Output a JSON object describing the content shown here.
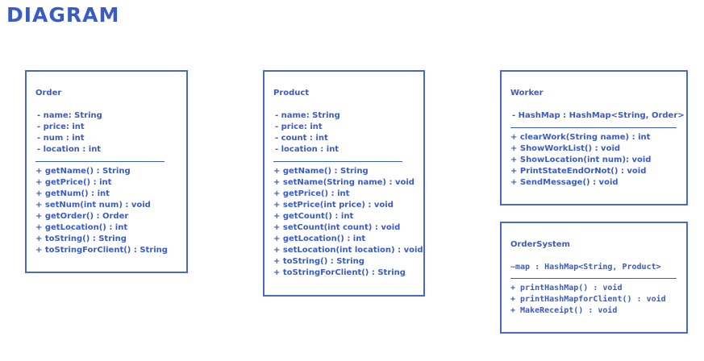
{
  "title": "DIAGRAM",
  "accent_color": "#3B5BC4",
  "classes": {
    "order": {
      "name": "Order",
      "attributes": [
        "- name: String",
        "- price: int",
        "- num : int",
        "- location : int"
      ],
      "methods": [
        "+ getName() : String",
        "+ getPrice() : int",
        "+ getNum() : int",
        "+ setNum(int num) : void",
        "+ getOrder() : Order",
        "+ getLocation() : int",
        "+ toString() : String",
        "+ toStringForClient() : String"
      ]
    },
    "product": {
      "name": "Product",
      "attributes": [
        "- name: String",
        "- price: int",
        "- count : int",
        "- location : int"
      ],
      "methods": [
        "+ getName() : String",
        "+ setName(String name) : void",
        "+ getPrice() : int",
        "+ setPrice(int price) : void",
        "+ getCount() : int",
        "+ setCount(int count) : void",
        "+ getLocation() : int",
        "+ setLocation(int location) : void",
        "+ toString() : String",
        "+ toStringForClient() : String"
      ]
    },
    "worker": {
      "name": "Worker",
      "attributes": [
        "- HashMap : HashMap<String, Order>"
      ],
      "methods": [
        "+ clearWork(String name) : int",
        "+ ShowWorkList() : void",
        "+ ShowLocation(int num): void",
        "+ PrintStateEndOrNot() : void",
        "+ SendMessage() : void"
      ]
    },
    "ordersystem": {
      "name": "OrderSystem",
      "attributes": [
        "~map : HashMap<String, Product>"
      ],
      "methods": [
        "+ printHashMap() : void",
        "+ printHashMapforClient() : void",
        "+ MakeReceipt() : void"
      ]
    }
  }
}
